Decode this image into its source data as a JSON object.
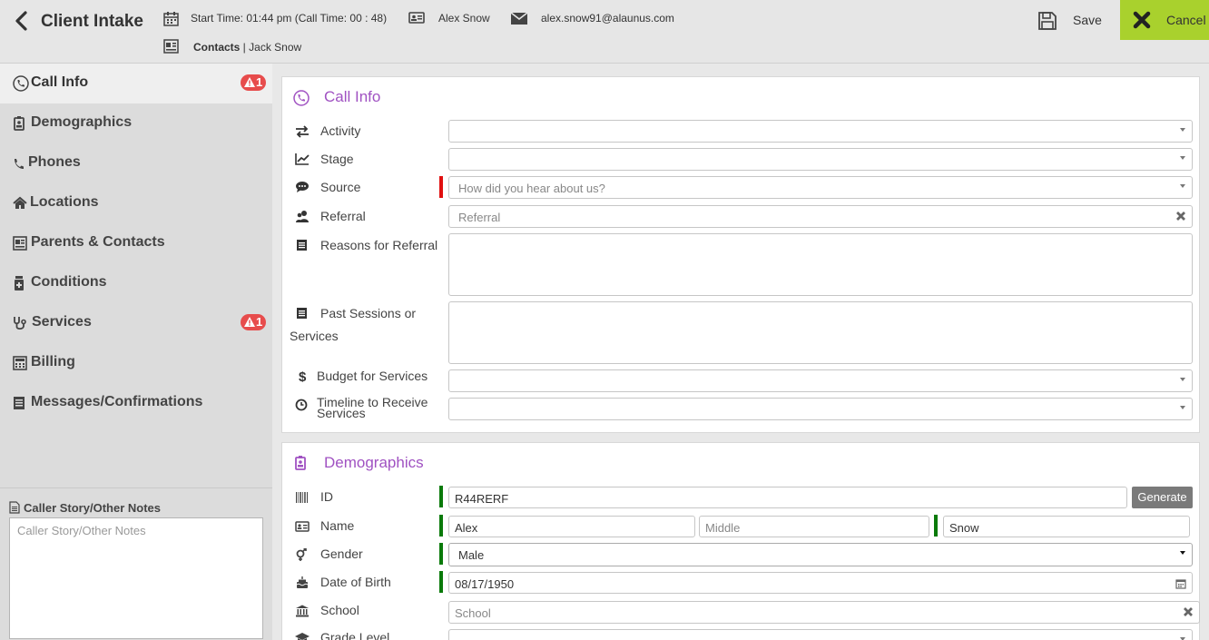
{
  "header": {
    "title": "Client Intake",
    "start_time": "Start Time: 01:44 pm (Call Time: 00 : 48)",
    "client_name": "Alex Snow",
    "email": "alex.snow91@alaunus.com",
    "contacts_label": "Contacts",
    "contacts_separator": " | ",
    "contacts_value": "Jack Snow",
    "save_label": "Save",
    "cancel_label": "Cancel"
  },
  "sidebar": {
    "items": [
      {
        "label": "Call Info",
        "icon": "phone-circle-icon",
        "badge": "1",
        "active": true
      },
      {
        "label": "Demographics",
        "icon": "id-badge-icon"
      },
      {
        "label": "Phones",
        "icon": "phone-icon"
      },
      {
        "label": "Locations",
        "icon": "home-icon"
      },
      {
        "label": "Parents & Contacts",
        "icon": "contact-card-icon"
      },
      {
        "label": "Conditions",
        "icon": "medical-bottle-icon"
      },
      {
        "label": "Services",
        "icon": "stethoscope-icon",
        "badge": "1"
      },
      {
        "label": "Billing",
        "icon": "billing-icon"
      },
      {
        "label": "Messages/Confirmations",
        "icon": "messages-icon"
      }
    ],
    "notes_title": "Caller Story/Other Notes",
    "notes_placeholder": "Caller Story/Other Notes"
  },
  "call_info": {
    "title": "Call Info",
    "activity_label": "Activity",
    "stage_label": "Stage",
    "source_label": "Source",
    "source_placeholder": "How did you hear about us?",
    "referral_label": "Referral",
    "referral_placeholder": "Referral",
    "reasons_label": "Reasons for Referral",
    "past_sessions_label_1": "Past Sessions or",
    "past_sessions_label_2": "Services",
    "budget_label": "Budget for Services",
    "timeline_label_1": "Timeline to Receive",
    "timeline_label_2": "Services"
  },
  "demographics": {
    "title": "Demographics",
    "id_label": "ID",
    "id_value": "R44RERF",
    "generate_label": "Generate",
    "name_label": "Name",
    "first_name": "Alex",
    "middle_placeholder": "Middle",
    "last_name": "Snow",
    "gender_label": "Gender",
    "gender_value": "Male",
    "dob_label": "Date of Birth",
    "dob_value": "08/17/1950",
    "school_label": "School",
    "school_placeholder": "School",
    "grade_label": "Grade Level"
  },
  "colors": {
    "accent_purple": "#a052c2",
    "cancel_green": "#a9d12d",
    "badge_red": "#e74c4c",
    "required_red": "#e01010",
    "valid_green": "#0a7a0a"
  }
}
